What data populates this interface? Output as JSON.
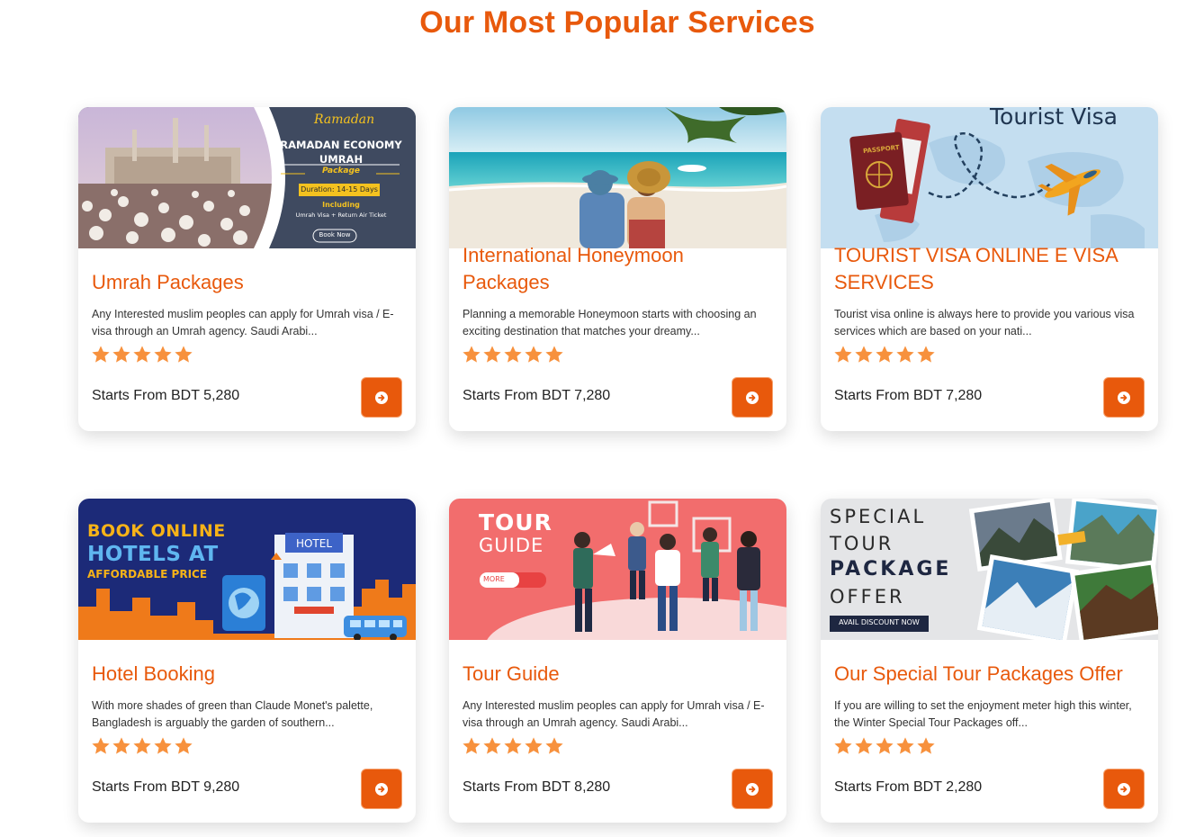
{
  "section": {
    "title": "Our Most Popular Services"
  },
  "colors": {
    "accent": "#e8590c",
    "star": "#f7913d"
  },
  "cards": [
    {
      "title": "Umrah Packages",
      "desc": "Any Interested muslim peoples can apply for Umrah visa / E-visa through an Umrah agency. Saudi Arabi...",
      "price": "Starts From BDT 5,280",
      "rating": 5,
      "banner": {
        "script": "Ramadan",
        "line1": "RAMADAN ECONOMY",
        "line2": "UMRAH",
        "line3": "Package",
        "duration": "Duration: 14-15 Days",
        "including": "Including",
        "includes": "Umrah Visa + Return Air Ticket",
        "cta": "Book Now"
      }
    },
    {
      "title": "International Honeymoon Packages",
      "desc": "Planning a memorable Honeymoon starts with choosing an exciting destination that matches your dreamy...",
      "price": "Starts From BDT 7,280",
      "rating": 5
    },
    {
      "title": "TOURIST VISA ONLINE E VISA SERVICES",
      "desc": "Tourist visa online is always here to provide you various visa services which are based on your nati...",
      "price": "Starts From BDT 7,280",
      "rating": 5,
      "banner": {
        "heading": "Tourist Visa",
        "passport": "PASSPORT"
      }
    },
    {
      "title": "Hotel Booking",
      "desc": "With more shades of green than Claude Monet's palette, Bangladesh is arguably the garden of southern...",
      "price": "Starts From BDT 9,280",
      "rating": 5,
      "banner": {
        "line1": "BOOK ONLINE",
        "line2": "HOTELS AT",
        "line3": "AFFORDABLE PRICE",
        "sign": "HOTEL"
      }
    },
    {
      "title": "Tour Guide",
      "desc": "Any Interested muslim peoples can apply for Umrah visa / E-visa through an Umrah agency. Saudi Arabi...",
      "price": "Starts From BDT 8,280",
      "rating": 5,
      "banner": {
        "line1": "TOUR",
        "line2": "GUIDE",
        "more": "MORE"
      }
    },
    {
      "title": "Our Special Tour Packages Offer",
      "desc": "If you are willing to set the enjoyment meter high this winter, the Winter Special Tour Packages off...",
      "price": "Starts From BDT 2,280",
      "rating": 5,
      "banner": {
        "line1": "SPECIAL",
        "line2": "TOUR",
        "line3": "PACKAGE",
        "line4": "OFFER",
        "cta": "AVAIL DISCOUNT NOW"
      }
    }
  ]
}
